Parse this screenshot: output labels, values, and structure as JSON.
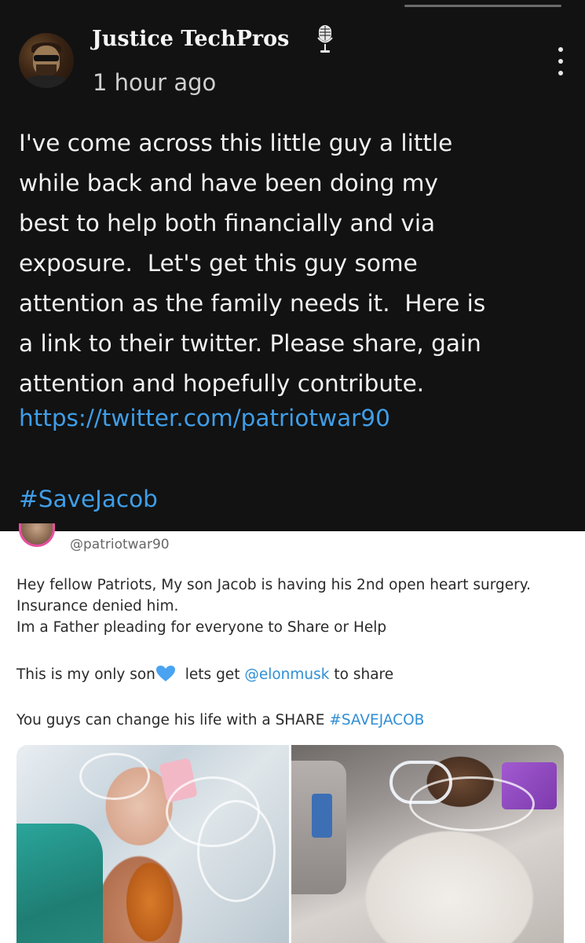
{
  "post": {
    "author_name": "Justice TechPros",
    "timestamp": "1 hour ago",
    "body_lines": [
      "I've come across this little guy a little",
      "while back and have been doing my",
      "best to help both financially and via",
      "exposure.  Let's get this guy some",
      "attention as the family needs it.  Here is",
      "a link to their twitter. Please share, gain",
      "attention and hopefully contribute."
    ],
    "link": "https://twitter.com/patriotwar90",
    "hashtag": "#SaveJacob"
  },
  "tweet": {
    "handle": "@patriotwar90",
    "line1": "Hey fellow Patriots, My son Jacob is having his 2nd open heart surgery.",
    "line2": "Insurance denied him.",
    "line3": "Im a Father pleading for everyone to Share or Help",
    "line4_pre": "This is my only son",
    "line4_mid": " lets get ",
    "line4_mention": "@elonmusk",
    "line4_post": " to share",
    "line5_pre": "You guys can change his life with a SHARE  ",
    "line5_tag": "#SAVEJACOB"
  },
  "colors": {
    "link_blue": "#3f9ee8",
    "tweet_link_blue": "#2f8fd6",
    "dark_bg": "#121212",
    "heart_blue": "#4aa3f0"
  },
  "icons": {
    "mic": "microphone-icon",
    "more": "more-vertical-icon",
    "heart": "blue-heart-icon"
  }
}
